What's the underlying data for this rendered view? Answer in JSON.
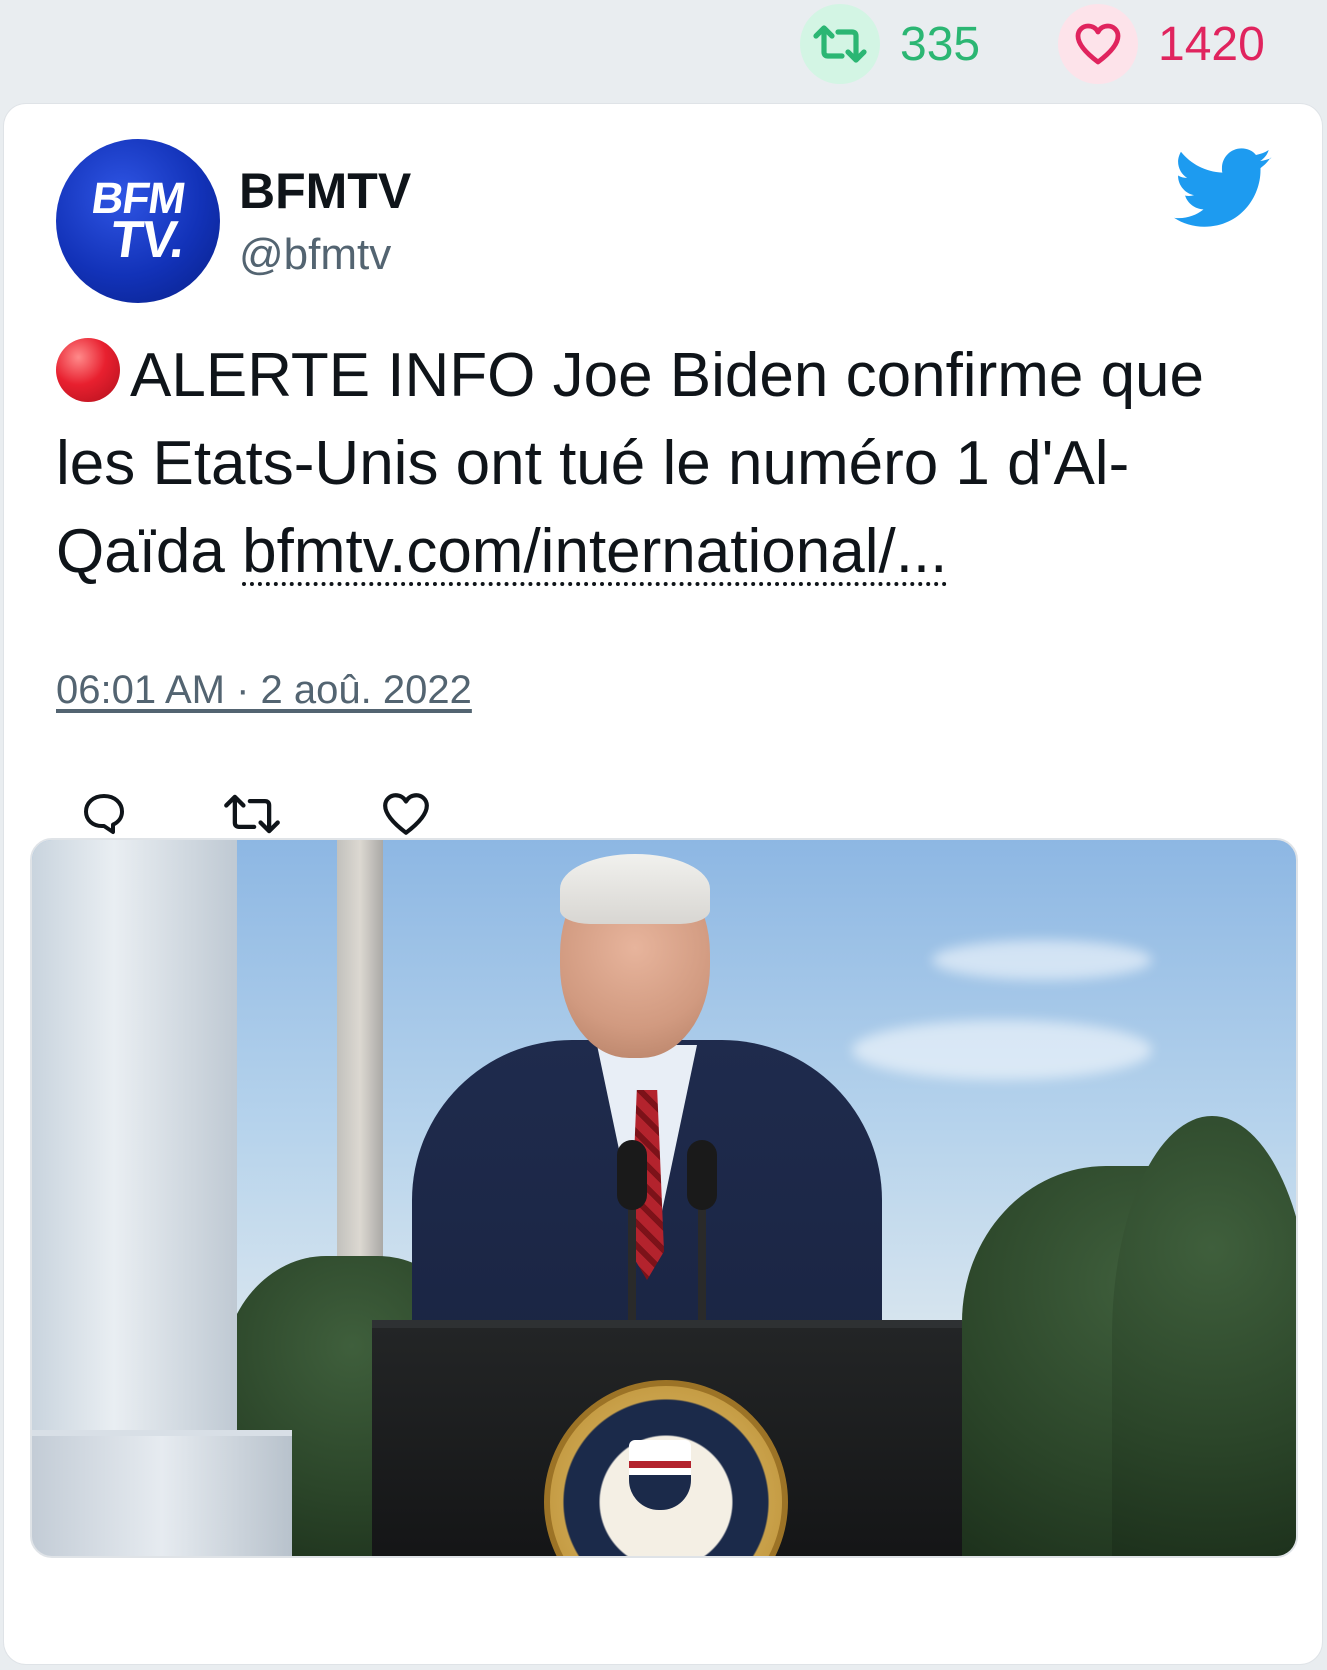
{
  "stats": {
    "retweets": "335",
    "likes": "1420",
    "retweet_color": "#2bb673",
    "like_color": "#e0245e"
  },
  "tweet": {
    "avatar_line1": "BFM",
    "avatar_line2": "TV.",
    "display_name": "BFMTV",
    "handle": "@bfmtv",
    "text_main": "ALERTE INFO Joe Biden confirme que les Etats-Unis ont tué le numéro 1 d'Al-Qaïda ",
    "link": "bfmtv.com/international/...",
    "timestamp": "06:01 AM · 2 aoû. 2022"
  },
  "icons": {
    "alert": "red-circle-icon",
    "brand": "twitter-bird-icon",
    "reply": "reply-icon",
    "retweet": "retweet-icon",
    "like": "heart-icon"
  },
  "colors": {
    "twitter_blue": "#1d9bf0",
    "text": "#0f1419",
    "muted": "#536471"
  }
}
